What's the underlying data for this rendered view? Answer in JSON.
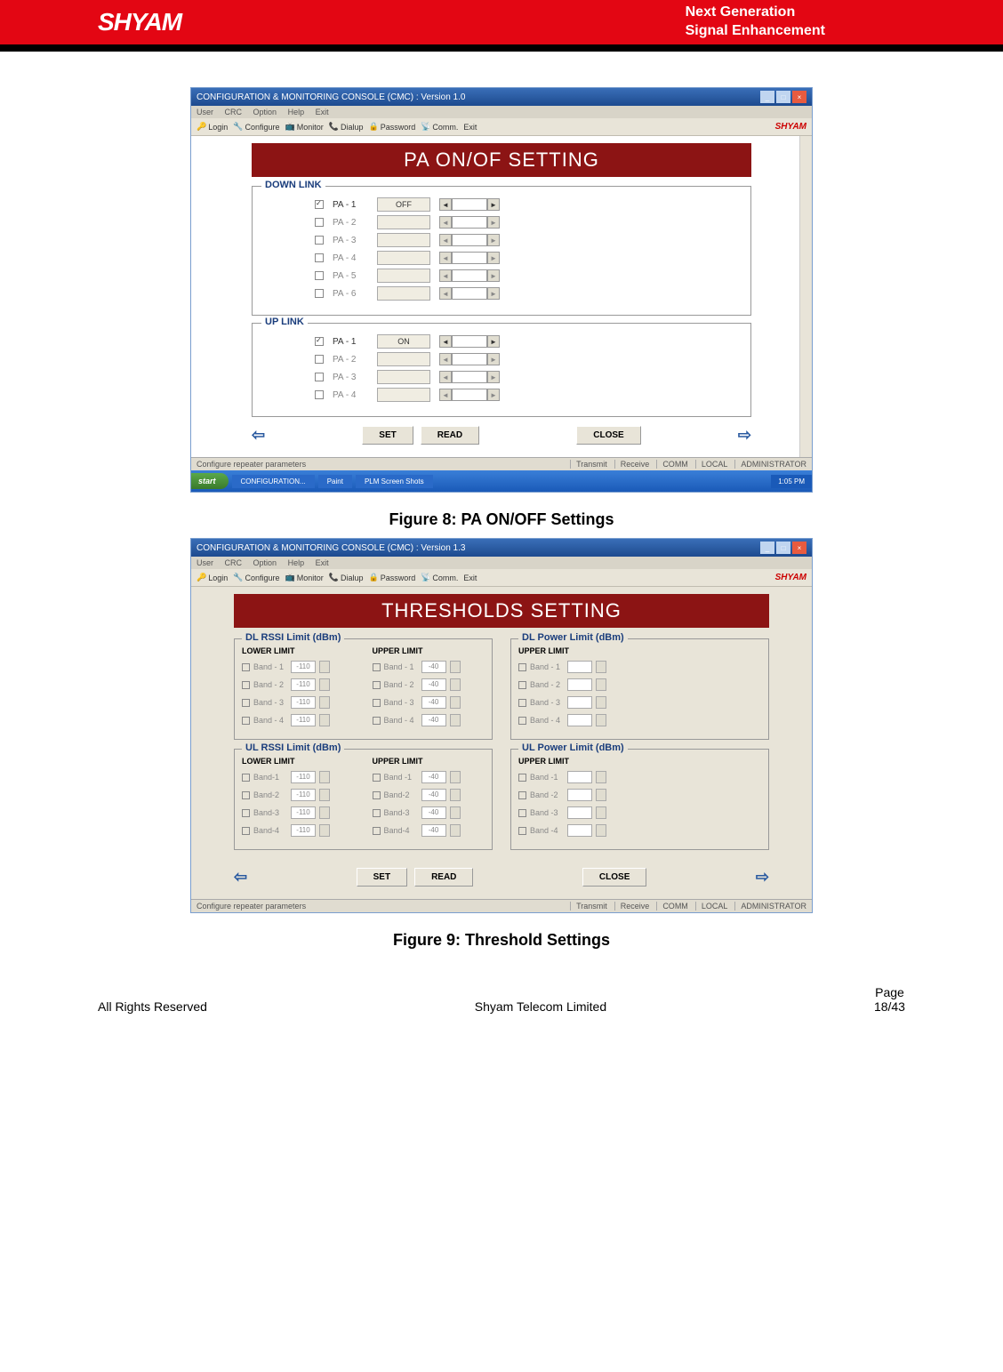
{
  "header": {
    "logo": "SHYAM",
    "tagline1": "Next Generation",
    "tagline2": "Signal Enhancement"
  },
  "figure8": {
    "caption": "Figure 8: PA ON/OFF Settings",
    "window_title": "CONFIGURATION & MONITORING CONSOLE (CMC) : Version 1.0",
    "menu": [
      "User",
      "CRC",
      "Option",
      "Help",
      "Exit"
    ],
    "toolbar": [
      "Login",
      "Configure",
      "Monitor",
      "Dialup",
      "Password",
      "Comm.",
      "Exit"
    ],
    "brand": "SHYAM",
    "heading": "PA ON/OF SETTING",
    "downlink_label": "DOWN LINK",
    "uplink_label": "UP LINK",
    "downlink_rows": [
      {
        "label": "PA - 1",
        "status": "OFF",
        "enabled": true
      },
      {
        "label": "PA - 2",
        "status": "",
        "enabled": false
      },
      {
        "label": "PA - 3",
        "status": "",
        "enabled": false
      },
      {
        "label": "PA - 4",
        "status": "",
        "enabled": false
      },
      {
        "label": "PA - 5",
        "status": "",
        "enabled": false
      },
      {
        "label": "PA - 6",
        "status": "",
        "enabled": false
      }
    ],
    "uplink_rows": [
      {
        "label": "PA - 1",
        "status": "ON",
        "enabled": true
      },
      {
        "label": "PA - 2",
        "status": "",
        "enabled": false
      },
      {
        "label": "PA - 3",
        "status": "",
        "enabled": false
      },
      {
        "label": "PA - 4",
        "status": "",
        "enabled": false
      }
    ],
    "buttons": {
      "set": "SET",
      "read": "READ",
      "close": "CLOSE"
    },
    "status_text": "Configure repeater parameters",
    "status_items": [
      "Transmit",
      "Receive",
      "COMM",
      "LOCAL",
      "ADMINISTRATOR"
    ],
    "taskbar": {
      "start": "start",
      "items": [
        "CONFIGURATION...",
        "Paint",
        "PLM Screen Shots"
      ],
      "time": "1:05 PM"
    }
  },
  "figure9": {
    "caption": "Figure 9: Threshold Settings",
    "window_title": "CONFIGURATION & MONITORING CONSOLE (CMC)  :  Version 1.3",
    "menu": [
      "User",
      "CRC",
      "Option",
      "Help",
      "Exit"
    ],
    "toolbar": [
      "Login",
      "Configure",
      "Monitor",
      "Dialup",
      "Password",
      "Comm.",
      "Exit"
    ],
    "brand": "SHYAM",
    "heading": "THRESHOLDS SETTING",
    "sections": {
      "dl_rssi": {
        "title": "DL RSSI Limit (dBm)",
        "lower_label": "LOWER LIMIT",
        "upper_label": "UPPER LIMIT",
        "lower": [
          {
            "label": "Band - 1",
            "val": "-110"
          },
          {
            "label": "Band - 2",
            "val": "-110"
          },
          {
            "label": "Band - 3",
            "val": "-110"
          },
          {
            "label": "Band - 4",
            "val": "-110"
          }
        ],
        "upper": [
          {
            "label": "Band - 1",
            "val": "-40"
          },
          {
            "label": "Band - 2",
            "val": "-40"
          },
          {
            "label": "Band - 3",
            "val": "-40"
          },
          {
            "label": "Band - 4",
            "val": "-40"
          }
        ]
      },
      "dl_power": {
        "title": "DL Power Limit (dBm)",
        "upper_label": "UPPER LIMIT",
        "upper": [
          {
            "label": "Band - 1",
            "val": ""
          },
          {
            "label": "Band - 2",
            "val": ""
          },
          {
            "label": "Band - 3",
            "val": ""
          },
          {
            "label": "Band - 4",
            "val": ""
          }
        ]
      },
      "ul_rssi": {
        "title": "UL RSSI Limit (dBm)",
        "lower_label": "LOWER LIMIT",
        "upper_label": "UPPER LIMIT",
        "lower": [
          {
            "label": "Band-1",
            "val": "-110"
          },
          {
            "label": "Band-2",
            "val": "-110"
          },
          {
            "label": "Band-3",
            "val": "-110"
          },
          {
            "label": "Band-4",
            "val": "-110"
          }
        ],
        "upper": [
          {
            "label": "Band -1",
            "val": "-40"
          },
          {
            "label": "Band-2",
            "val": "-40"
          },
          {
            "label": "Band-3",
            "val": "-40"
          },
          {
            "label": "Band-4",
            "val": "-40"
          }
        ]
      },
      "ul_power": {
        "title": "UL Power Limit (dBm)",
        "upper_label": "UPPER LIMIT",
        "upper": [
          {
            "label": "Band -1",
            "val": ""
          },
          {
            "label": "Band -2",
            "val": ""
          },
          {
            "label": "Band -3",
            "val": ""
          },
          {
            "label": "Band -4",
            "val": ""
          }
        ]
      }
    },
    "buttons": {
      "set": "SET",
      "read": "READ",
      "close": "CLOSE"
    },
    "status_text": "Configure repeater parameters",
    "status_items": [
      "Transmit",
      "Receive",
      "COMM",
      "LOCAL",
      "ADMINISTRATOR"
    ]
  },
  "footer": {
    "left": "All Rights Reserved",
    "center": "Shyam Telecom Limited",
    "page_label": "Page",
    "page_num": "18/43"
  }
}
